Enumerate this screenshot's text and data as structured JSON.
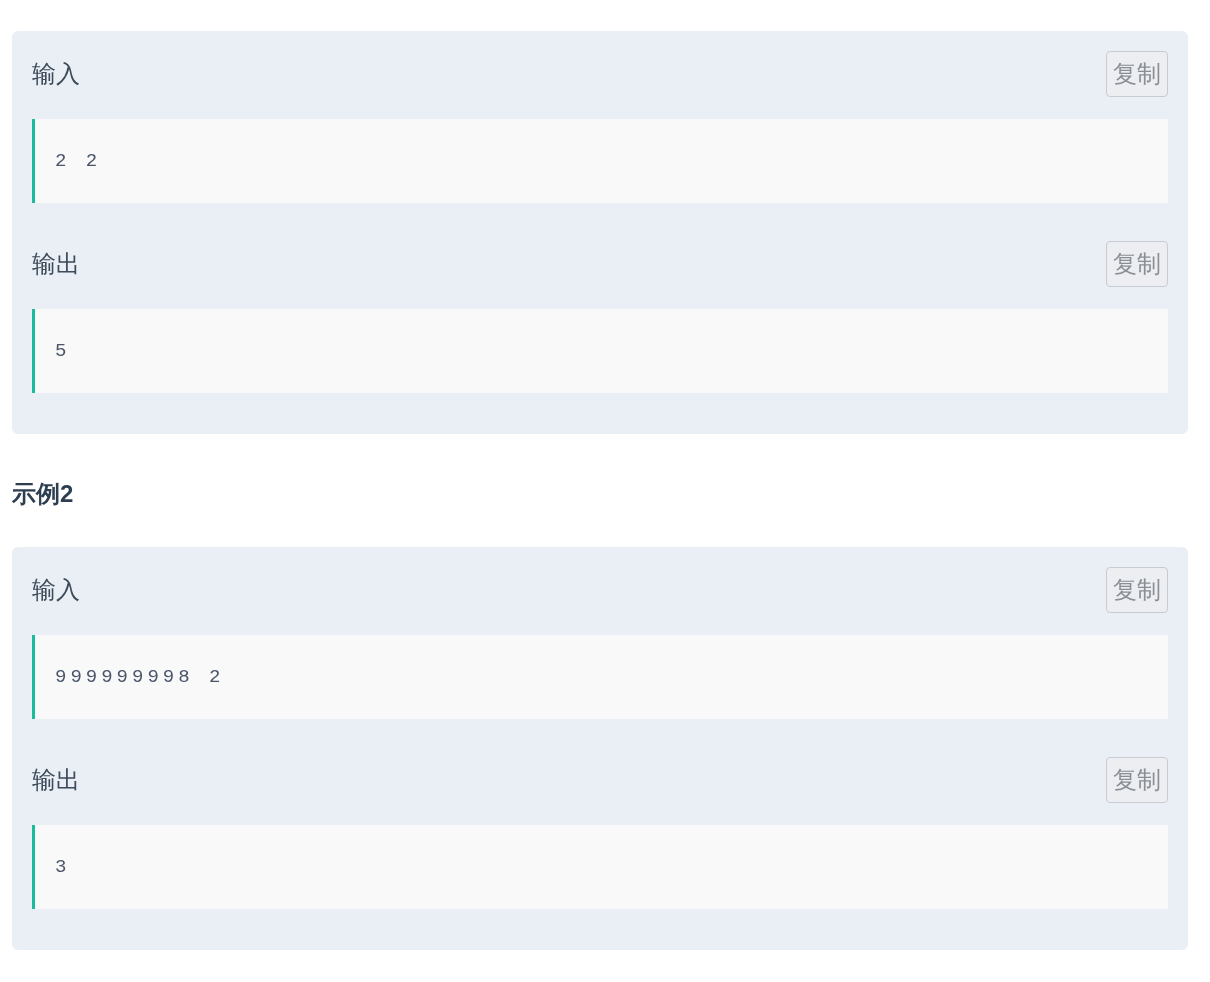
{
  "examples": [
    {
      "sections": [
        {
          "label": "输入",
          "copy_button": "复制",
          "code": "2 2"
        },
        {
          "label": "输出",
          "copy_button": "复制",
          "code": "5"
        }
      ]
    },
    {
      "title": "示例2",
      "sections": [
        {
          "label": "输入",
          "copy_button": "复制",
          "code": "999999998 2"
        },
        {
          "label": "输出",
          "copy_button": "复制",
          "code": "3"
        }
      ]
    }
  ]
}
